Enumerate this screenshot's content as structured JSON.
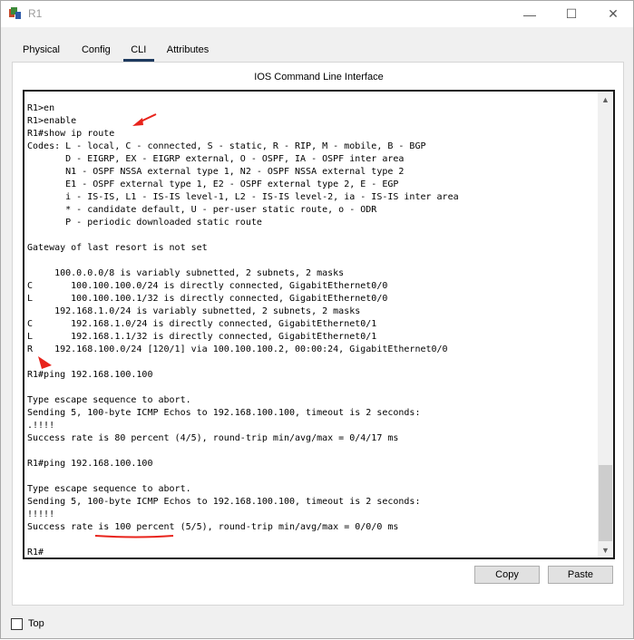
{
  "window": {
    "title": "R1",
    "icon": "router-app-icon",
    "controls": {
      "minimize": "—",
      "maximize": "☐",
      "close": "✕"
    }
  },
  "tabs": [
    {
      "label": "Physical",
      "active": false
    },
    {
      "label": "Config",
      "active": false
    },
    {
      "label": "CLI",
      "active": true
    },
    {
      "label": "Attributes",
      "active": false
    }
  ],
  "panel": {
    "title": "IOS Command Line Interface"
  },
  "terminal": {
    "lines": [
      "R1>en",
      "R1>enable",
      "R1#show ip route",
      "Codes: L - local, C - connected, S - static, R - RIP, M - mobile, B - BGP",
      "       D - EIGRP, EX - EIGRP external, O - OSPF, IA - OSPF inter area",
      "       N1 - OSPF NSSA external type 1, N2 - OSPF NSSA external type 2",
      "       E1 - OSPF external type 1, E2 - OSPF external type 2, E - EGP",
      "       i - IS-IS, L1 - IS-IS level-1, L2 - IS-IS level-2, ia - IS-IS inter area",
      "       * - candidate default, U - per-user static route, o - ODR",
      "       P - periodic downloaded static route",
      "",
      "Gateway of last resort is not set",
      "",
      "     100.0.0.0/8 is variably subnetted, 2 subnets, 2 masks",
      "C       100.100.100.0/24 is directly connected, GigabitEthernet0/0",
      "L       100.100.100.1/32 is directly connected, GigabitEthernet0/0",
      "     192.168.1.0/24 is variably subnetted, 2 subnets, 2 masks",
      "C       192.168.1.0/24 is directly connected, GigabitEthernet0/1",
      "L       192.168.1.1/32 is directly connected, GigabitEthernet0/1",
      "R    192.168.100.0/24 [120/1] via 100.100.100.2, 00:00:24, GigabitEthernet0/0",
      "",
      "R1#ping 192.168.100.100",
      "",
      "Type escape sequence to abort.",
      "Sending 5, 100-byte ICMP Echos to 192.168.100.100, timeout is 2 seconds:",
      ".!!!!",
      "Success rate is 80 percent (4/5), round-trip min/avg/max = 0/4/17 ms",
      "",
      "R1#ping 192.168.100.100",
      "",
      "Type escape sequence to abort.",
      "Sending 5, 100-byte ICMP Echos to 192.168.100.100, timeout is 2 seconds:",
      "!!!!!",
      "Success rate is 100 percent (5/5), round-trip min/avg/max = 0/0/0 ms",
      "",
      "R1#"
    ]
  },
  "buttons": {
    "copy": "Copy",
    "paste": "Paste"
  },
  "footer": {
    "top_label": "Top",
    "top_checked": false
  },
  "colors": {
    "annotation": "#e8231b",
    "tab_underline": "#1e3a5f"
  }
}
